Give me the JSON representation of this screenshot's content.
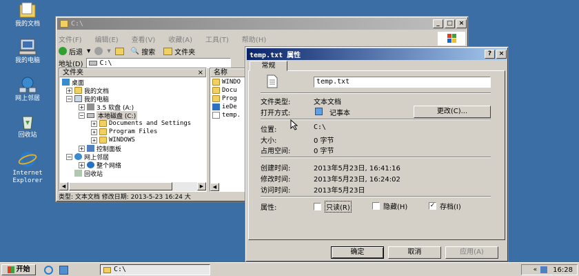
{
  "desktop": {
    "icons": [
      {
        "label": "我的文档",
        "icon": "my-documents-icon"
      },
      {
        "label": "我的电脑",
        "icon": "my-computer-icon"
      },
      {
        "label": "网上邻居",
        "icon": "network-places-icon"
      },
      {
        "label": "回收站",
        "icon": "recycle-bin-icon"
      },
      {
        "label1": "Internet",
        "label2": "Explorer",
        "icon": "internet-explorer-icon"
      }
    ]
  },
  "explorer": {
    "title": "C:\\",
    "menu": [
      "文件(F)",
      "编辑(E)",
      "查看(V)",
      "收藏(A)",
      "工具(T)",
      "帮助(H)"
    ],
    "toolbar": {
      "back": "后退",
      "search": "搜索",
      "folders": "文件夹"
    },
    "address": {
      "label": "地址(D)",
      "value": "C:\\"
    },
    "tree_header": "文件夹",
    "tree": {
      "desktop": "桌面",
      "my_documents": "我的文档",
      "my_computer": "我的电脑",
      "floppy": "3.5 软盘 (A:)",
      "local_disk": "本地磁盘 (C:)",
      "docs_settings": "Documents and Settings",
      "program_files": "Program Files",
      "windows": "WINDOWS",
      "control_panel": "控制面板",
      "network": "网上邻居",
      "entire_network": "整个网络",
      "recycle_bin": "回收站"
    },
    "list_header": "名称",
    "files": [
      "WINDO",
      "Docu",
      "Prog",
      "ieDe",
      "temp."
    ],
    "status": "类型: 文本文档 修改日期: 2013-5-23 16:24 大"
  },
  "dialog": {
    "title": "temp.txt 属性",
    "tab": "常规",
    "filename": "temp.txt",
    "rows": {
      "type_label": "文件类型:",
      "type_value": "文本文档",
      "open_label": "打开方式:",
      "open_value": "记事本",
      "change_btn": "更改(C)...",
      "location_label": "位置:",
      "location_value": "C:\\",
      "size_label": "大小:",
      "size_value": "0 字节",
      "disk_label": "占用空间:",
      "disk_value": "0 字节",
      "created_label": "创建时间:",
      "created_value": "2013年5月23日, 16:41:16",
      "modified_label": "修改时间:",
      "modified_value": "2013年5月23日, 16:24:02",
      "accessed_label": "访问时间:",
      "accessed_value": "2013年5月23日",
      "attr_label": "属性:",
      "readonly": "只读(R)",
      "hidden": "隐藏(H)",
      "archive": "存档(I)"
    },
    "attributes": {
      "readonly": false,
      "hidden": false,
      "archive": true
    },
    "buttons": {
      "ok": "确定",
      "cancel": "取消",
      "apply": "应用(A)"
    }
  },
  "taskbar": {
    "start": "开始",
    "task": "C:\\",
    "clock": "16:28"
  }
}
